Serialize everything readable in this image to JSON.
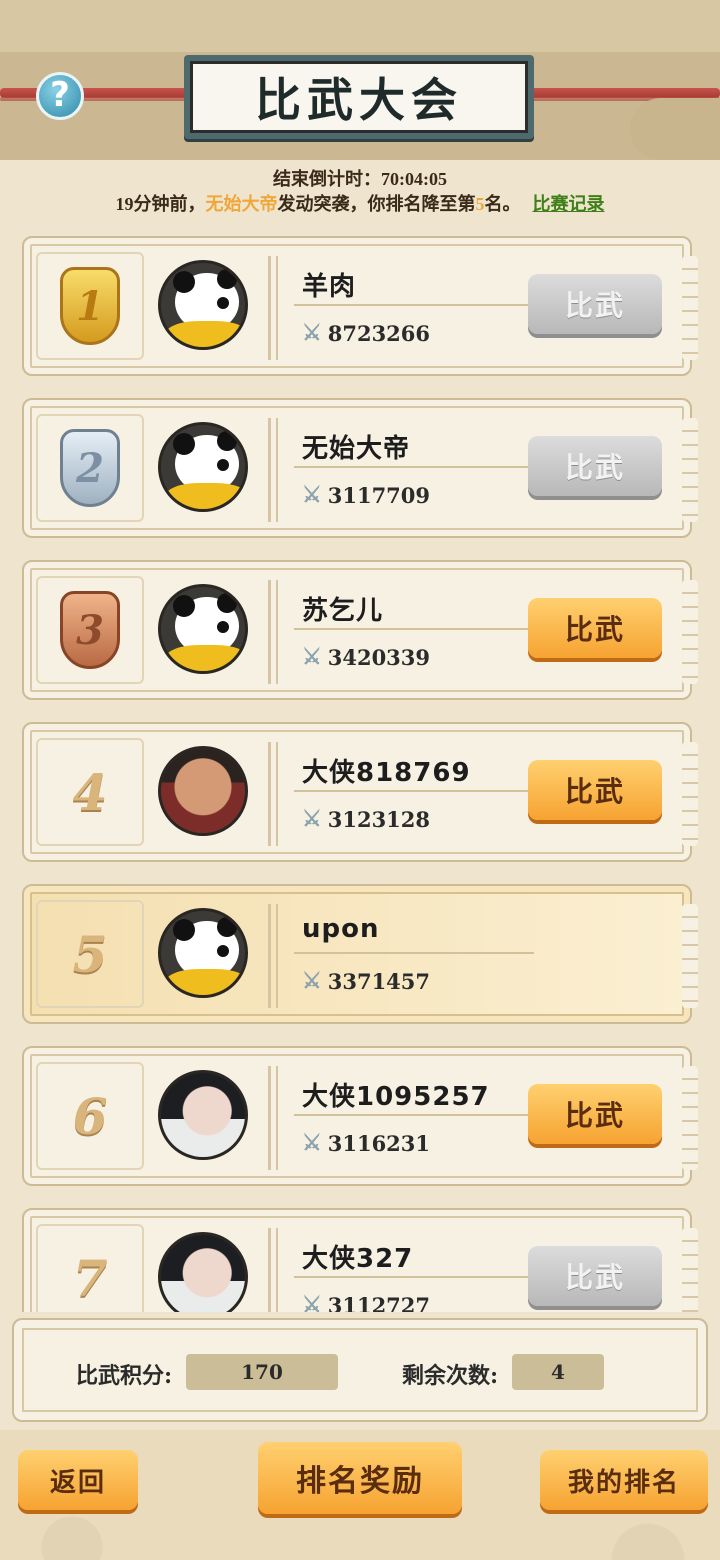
{
  "header": {
    "title": "比武大会",
    "help_icon": "?",
    "countdown_label": "结束倒计时：",
    "countdown_value": "70:04:05"
  },
  "notice": {
    "prefix": "19分钟前，",
    "attacker": "无始大帝",
    "middle": "发动突袭，你排名降至第",
    "rank": "5",
    "suffix": "名。",
    "link": "比赛记录"
  },
  "entries": [
    {
      "rank": "1",
      "name": "羊肉",
      "power": "8723266",
      "button": "比武",
      "button_state": "disabled",
      "avatar": "panda"
    },
    {
      "rank": "2",
      "name": "无始大帝",
      "power": "3117709",
      "button": "比武",
      "button_state": "disabled",
      "avatar": "panda"
    },
    {
      "rank": "3",
      "name": "苏乞儿",
      "power": "3420339",
      "button": "比武",
      "button_state": "active",
      "avatar": "panda"
    },
    {
      "rank": "4",
      "name": "大侠818769",
      "power": "3123128",
      "button": "比武",
      "button_state": "active",
      "avatar": "warrior"
    },
    {
      "rank": "5",
      "name": "upon",
      "power": "3371457",
      "button": "",
      "button_state": "self",
      "avatar": "panda"
    },
    {
      "rank": "6",
      "name": "大侠1095257",
      "power": "3116231",
      "button": "比武",
      "button_state": "active",
      "avatar": "scholar"
    },
    {
      "rank": "7",
      "name": "大侠327",
      "power": "3112727",
      "button": "比武",
      "button_state": "disabled",
      "avatar": "scholar"
    }
  ],
  "stats": {
    "points_label": "比武积分:",
    "points_value": "170",
    "remaining_label": "剩余次数:",
    "remaining_value": "4"
  },
  "footer": {
    "back": "返回",
    "rewards": "排名奖励",
    "my_rank": "我的排名"
  },
  "colors": {
    "accent_orange": "#f6a331",
    "highlight_text": "#f0a73a",
    "link_green": "#3f7f19",
    "panel_bg": "#f7f1e3"
  }
}
